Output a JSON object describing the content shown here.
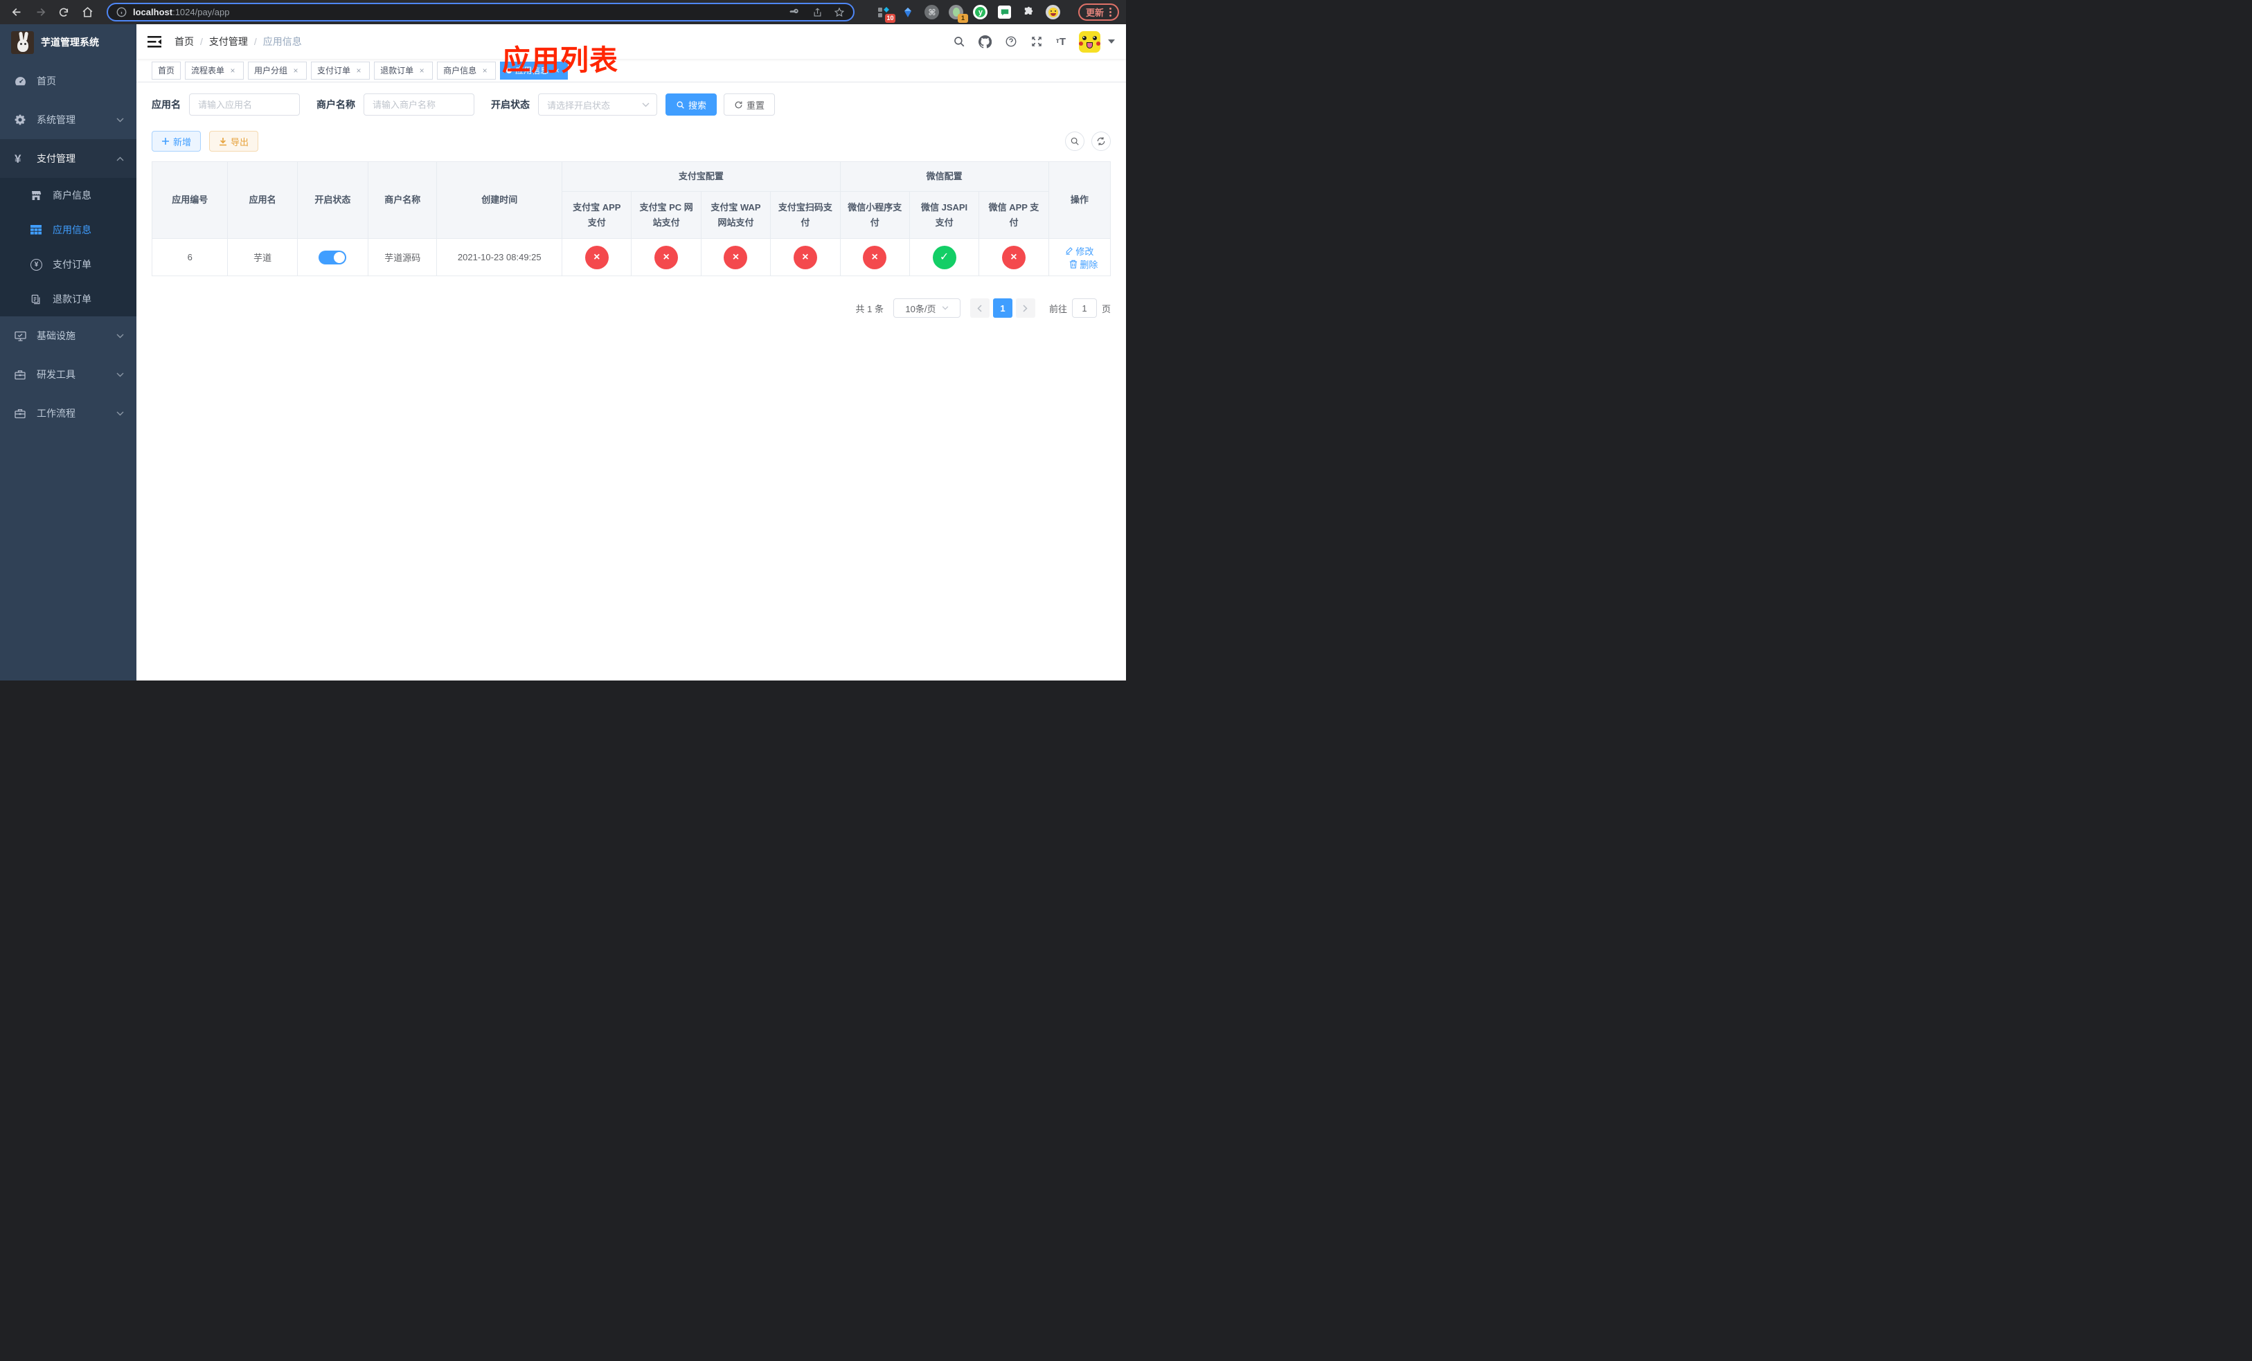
{
  "browser": {
    "url_host": "localhost",
    "url_rest": ":1024/pay/app",
    "update_label": "更新",
    "ext_badge_a": "10",
    "ext_badge_b": "1"
  },
  "sidebar": {
    "title": "芋道管理系统",
    "items": [
      {
        "label": "首页",
        "icon": "dashboard-icon"
      },
      {
        "label": "系统管理",
        "icon": "gear-icon",
        "expandable": true
      },
      {
        "label": "支付管理",
        "icon": "yen-icon",
        "expandable": true,
        "expanded": true,
        "children": [
          {
            "label": "商户信息",
            "icon": "store-icon"
          },
          {
            "label": "应用信息",
            "icon": "grid-icon",
            "active": true
          },
          {
            "label": "支付订单",
            "icon": "yen-circle-icon"
          },
          {
            "label": "退款订单",
            "icon": "document-icon"
          }
        ]
      },
      {
        "label": "基础设施",
        "icon": "monitor-icon",
        "expandable": true
      },
      {
        "label": "研发工具",
        "icon": "toolbox-icon",
        "expandable": true
      },
      {
        "label": "工作流程",
        "icon": "toolbox-icon",
        "expandable": true
      }
    ]
  },
  "navbar": {
    "breadcrumb": {
      "home": "首页",
      "section": "支付管理",
      "current": "应用信息",
      "separator": "/"
    },
    "annotation": "应用列表"
  },
  "tags": [
    {
      "label": "首页",
      "closable": false,
      "active": false
    },
    {
      "label": "流程表单",
      "closable": true,
      "active": false
    },
    {
      "label": "用户分组",
      "closable": true,
      "active": false
    },
    {
      "label": "支付订单",
      "closable": true,
      "active": false
    },
    {
      "label": "退款订单",
      "closable": true,
      "active": false
    },
    {
      "label": "商户信息",
      "closable": true,
      "active": false
    },
    {
      "label": "应用信息",
      "closable": true,
      "active": true
    }
  ],
  "filters": {
    "app_name_label": "应用名",
    "app_name_placeholder": "请输入应用名",
    "merchant_label": "商户名称",
    "merchant_placeholder": "请输入商户名称",
    "status_label": "开启状态",
    "status_placeholder": "请选择开启状态",
    "search_label": "搜索",
    "reset_label": "重置"
  },
  "toolbar": {
    "add_label": "新增",
    "export_label": "导出"
  },
  "table": {
    "columns": {
      "app_id": "应用编号",
      "app_name": "应用名",
      "status": "开启状态",
      "merchant": "商户名称",
      "created": "创建时间",
      "operation": "操作"
    },
    "groups": {
      "alipay": "支付宝配置",
      "wechat": "微信配置"
    },
    "sub_columns": [
      "支付宝 APP 支付",
      "支付宝 PC 网站支付",
      "支付宝 WAP 网站支付",
      "支付宝扫码支付",
      "微信小程序支付",
      "微信 JSAPI 支付",
      "微信 APP 支付"
    ],
    "row": {
      "app_id": "6",
      "app_name": "芋道",
      "enabled": true,
      "merchant": "芋道源码",
      "created": "2021-10-23 08:49:25",
      "channels": [
        {
          "name": "alipay-app",
          "enabled": false
        },
        {
          "name": "alipay-pc",
          "enabled": false
        },
        {
          "name": "alipay-wap",
          "enabled": false
        },
        {
          "name": "alipay-qr",
          "enabled": false
        },
        {
          "name": "wechat-mini",
          "enabled": false
        },
        {
          "name": "wechat-jsapi",
          "enabled": true
        },
        {
          "name": "wechat-app",
          "enabled": false
        }
      ],
      "edit_label": "修改",
      "delete_label": "删除"
    }
  },
  "pagination": {
    "total": "共 1 条",
    "page_size": "10条/页",
    "page": "1",
    "goto_prefix": "前往",
    "goto_value": "1",
    "goto_suffix": "页"
  },
  "icons": {
    "close": "×",
    "cross": "×",
    "check": "✓"
  },
  "colors": {
    "accent": "#409eff",
    "success": "#13ce66",
    "danger": "#f4494d",
    "warning": "#e6a23c",
    "sidebar": "#304156"
  }
}
